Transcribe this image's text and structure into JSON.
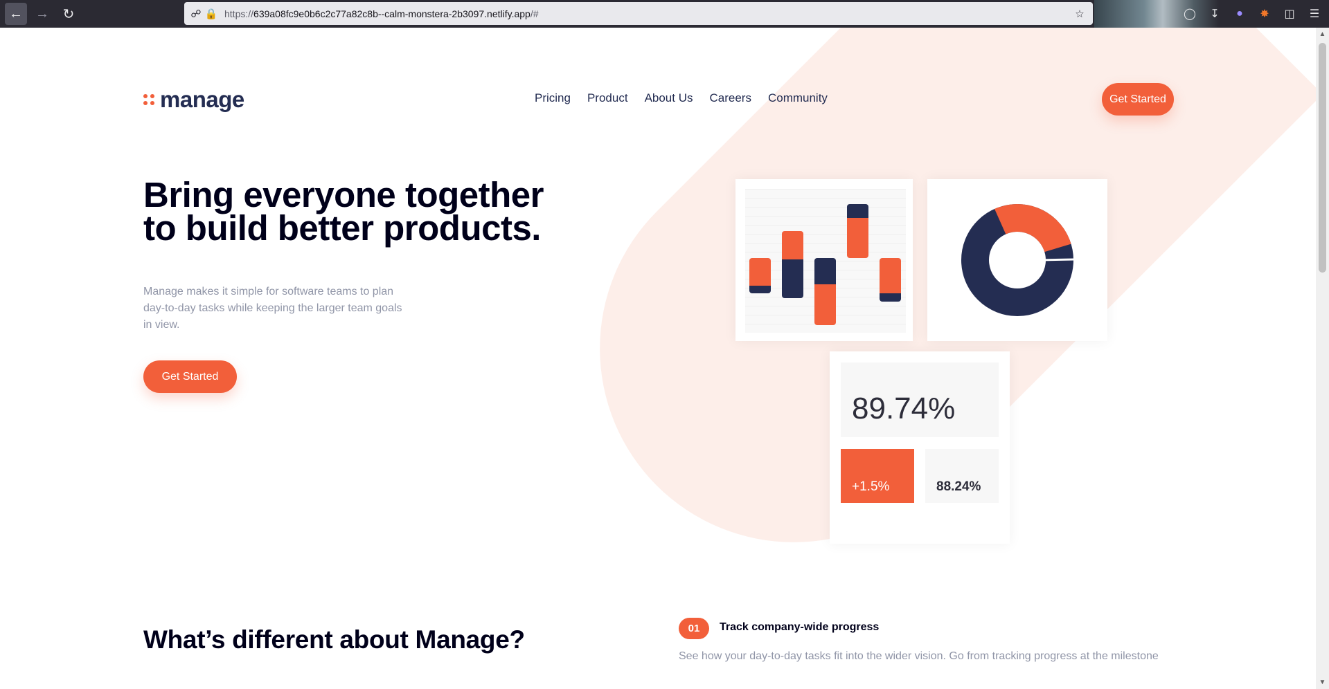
{
  "browser": {
    "url_prefix": "https://",
    "url_host": "639a08fc9e0b6c2c77a82c8b--calm-monstera-2b3097.netlify.app",
    "url_suffix": "/#"
  },
  "header": {
    "logo_text": "manage",
    "nav": [
      "Pricing",
      "Product",
      "About Us",
      "Careers",
      "Community"
    ],
    "cta_label": "Get Started"
  },
  "hero": {
    "title_line1": "Bring everyone together",
    "title_line2": "to build better products.",
    "description": "Manage makes it simple for software teams to plan day-to-day tasks while keeping the larger team goals in view.",
    "cta_label": "Get Started"
  },
  "illustration": {
    "stat_main": "89.74%",
    "stat_change": "+1.5%",
    "stat_secondary": "88.24%",
    "donut_orange_share": 0.27,
    "colors": {
      "accent": "#f25f3a",
      "navy": "#242d52",
      "pale": "#fdeee9"
    }
  },
  "section": {
    "title": "What’s different about Manage?",
    "feature_number": "01",
    "feature_title": "Track company-wide progress",
    "feature_desc": "See how your day-to-day tasks fit into the wider vision. Go from tracking progress at the milestone"
  }
}
